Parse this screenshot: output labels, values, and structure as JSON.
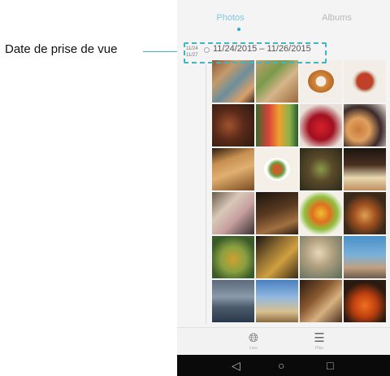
{
  "annotation": {
    "label": "Date de prise de vue"
  },
  "tabs": [
    {
      "label": "Photos",
      "active": true
    },
    {
      "label": "Albums",
      "active": false
    }
  ],
  "timeline": {
    "marker_start": "11/24",
    "marker_end": "11/27",
    "date_range": "11/24/2015 – 11/26/2015"
  },
  "bottom_bar": [
    {
      "icon": "globe-icon",
      "label": "Lieu"
    },
    {
      "icon": "menu-icon",
      "label": "Plus"
    }
  ],
  "nav": {
    "back": "◁",
    "home": "○",
    "recent": "□"
  },
  "colors": {
    "highlight": "#3fb6c2",
    "active_tab": "#2aa6dc",
    "nav_bar": "#0a0a0a"
  },
  "thumbnails": [
    "photo-collage",
    "photo-collage",
    "donuts",
    "pizza",
    "dessert-plate",
    "vegetables",
    "strawberries",
    "donuts",
    "bread",
    "salad-plate",
    "food-platter",
    "cake",
    "noodles",
    "bread-basket",
    "fruit-stack",
    "cupcakes",
    "soup-bowl",
    "tea-set",
    "portrait",
    "beach",
    "cloudy-sea",
    "pier",
    "bicycle",
    "pumpkins"
  ]
}
